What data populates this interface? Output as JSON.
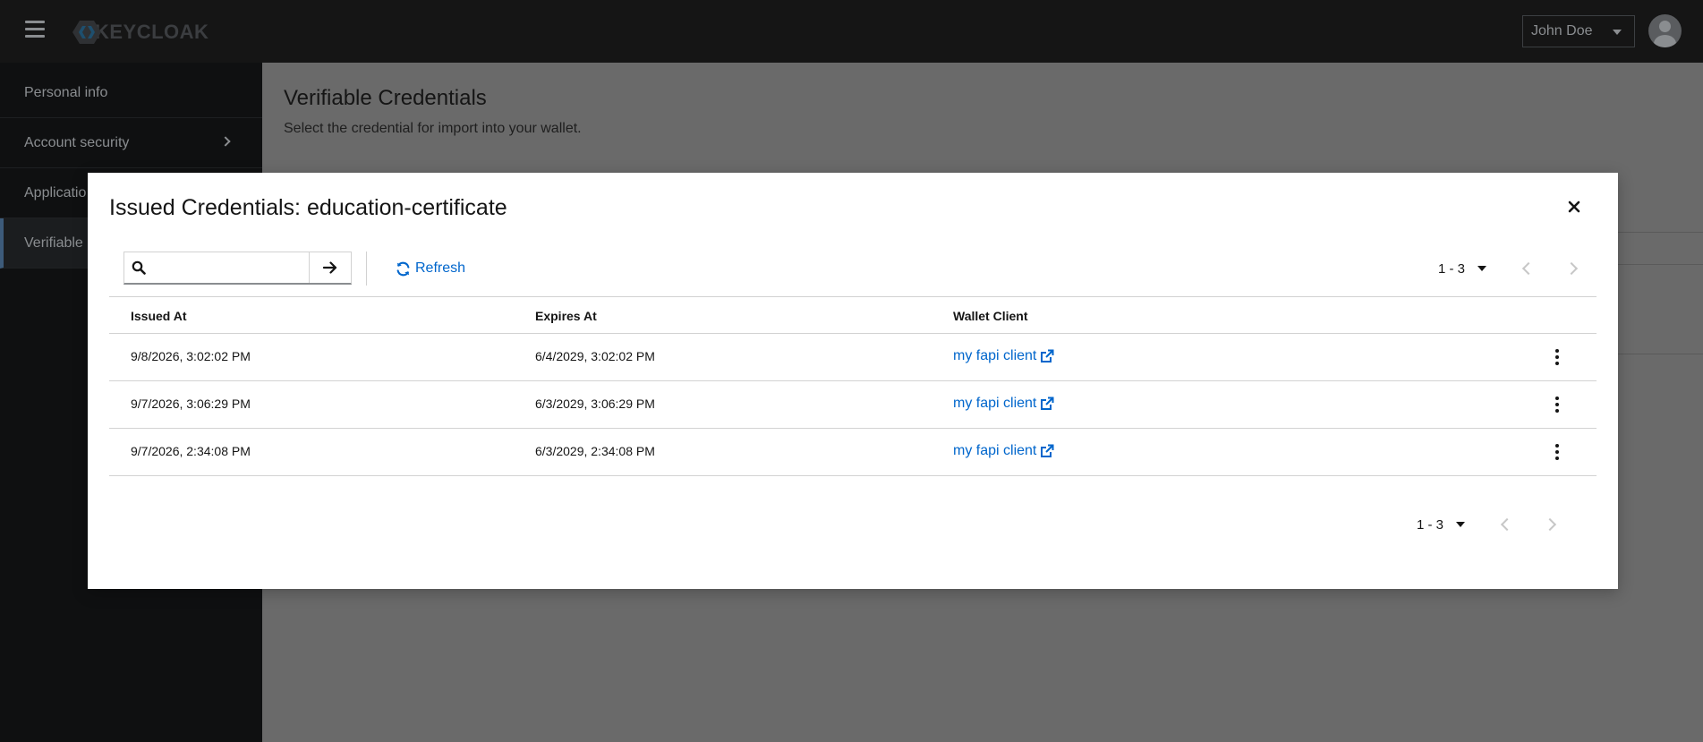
{
  "header": {
    "logo_text": "KEYCLOAK",
    "user_name": "John Doe",
    "menu_icon": "hamburger-icon",
    "avatar_icon": "user-avatar-icon"
  },
  "sidebar": {
    "items": [
      {
        "label": "Personal info"
      },
      {
        "label": "Account security"
      },
      {
        "label": "Applicatio"
      },
      {
        "label": "Verifiable"
      }
    ]
  },
  "main": {
    "title": "Verifiable Credentials",
    "subtitle": "Select the credential for import into your wallet."
  },
  "modal": {
    "title": "Issued Credentials: education-certificate",
    "search": {
      "value": "",
      "placeholder": ""
    },
    "refresh_label": "Refresh",
    "pagination_top": {
      "range": "1 - 3"
    },
    "pagination_bottom": {
      "range": "1 - 3"
    },
    "columns": [
      "Issued At",
      "Expires At",
      "Wallet Client"
    ],
    "rows": [
      {
        "issued_at": "9/8/2026, 3:02:02 PM",
        "expires_at": "6/4/2029, 3:02:02 PM",
        "wallet_client": "my fapi client"
      },
      {
        "issued_at": "9/7/2026, 3:06:29 PM",
        "expires_at": "6/3/2029, 3:06:29 PM",
        "wallet_client": "my fapi client"
      },
      {
        "issued_at": "9/7/2026, 2:34:08 PM",
        "expires_at": "6/3/2029, 2:34:08 PM",
        "wallet_client": "my fapi client"
      }
    ]
  },
  "colors": {
    "masthead": "#151515",
    "sidebar": "#0f1011",
    "backdrop": "#6a6a6a",
    "link": "#0066cc",
    "modal_bg": "#ffffff"
  }
}
